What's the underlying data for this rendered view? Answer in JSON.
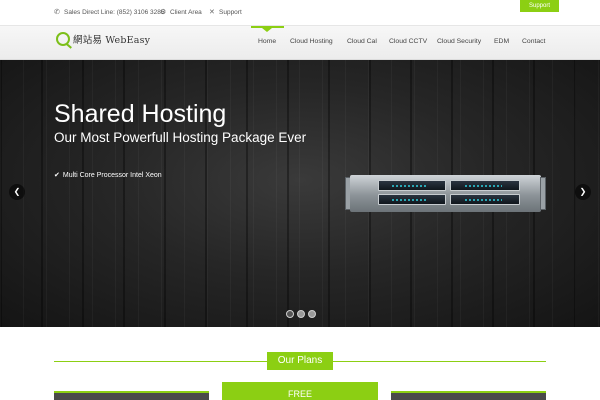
{
  "topbar": {
    "sales_line": "Sales Direct Line: (852) 3106 3285",
    "client_area": "Client Area",
    "support": "Support",
    "support_tab": "Support"
  },
  "logo": {
    "text": "網站易 WebEasy"
  },
  "nav": {
    "items": [
      "Home",
      "Cloud Hosting",
      "Cloud Cal",
      "Cloud CCTV",
      "Cloud Security",
      "EDM",
      "Contact"
    ],
    "active": "Home"
  },
  "hero": {
    "title": "Shared Hosting",
    "subtitle": "Our Most Powerfull Hosting Package Ever",
    "feature": "Multi Core Processor Intel Xeon",
    "slides": 3,
    "active_slide": 1
  },
  "plans": {
    "title": "Our Plans",
    "featured_label": "FREE"
  },
  "colors": {
    "accent": "#8ccf13",
    "hero_bg": "#262626"
  },
  "icons": [
    "phone-icon",
    "gears-icon",
    "wrench-icon",
    "check-icon",
    "chevron-left-icon",
    "chevron-right-icon"
  ]
}
